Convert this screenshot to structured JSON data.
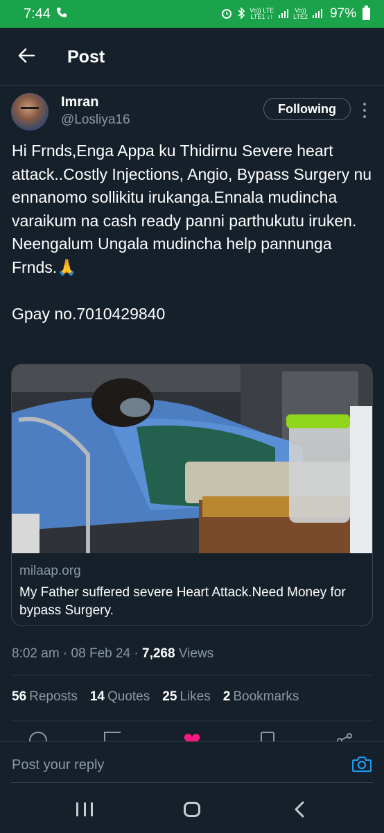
{
  "status_bar": {
    "time": "7:44",
    "network_left": "Vo)) LTE\nLTE1 ↓↑",
    "network_right": "Vo))\nLTE2",
    "battery": "97%",
    "bg_color": "#1aa34a"
  },
  "header": {
    "title": "Post",
    "back_icon": "arrow-left-icon"
  },
  "author": {
    "name": "Imran",
    "handle": "@Losliya16",
    "follow_label": "Following"
  },
  "post": {
    "text": "Hi Frnds,Enga Appa ku Thidirnu Severe heart attack..Costly Injections, Angio, Bypass Surgery nu ennanomo sollikitu irukanga.Ennala mudincha varaikum na cash ready panni parthukutu iruken. Neengalum Ungala mudincha help pannunga Frnds.🙏\n\nGpay no.7010429840"
  },
  "card": {
    "domain": "milaap.org",
    "description": "My Father suffered severe Heart Attack.Need Money for bypass Surgery."
  },
  "meta": {
    "time": "8:02 am",
    "separator": " · ",
    "date": "08 Feb 24",
    "views_count": "7,268",
    "views_label": " Views"
  },
  "stats": [
    {
      "count": "56",
      "label": "Reposts"
    },
    {
      "count": "14",
      "label": "Quotes"
    },
    {
      "count": "25",
      "label": "Likes"
    },
    {
      "count": "2",
      "label": "Bookmarks"
    }
  ],
  "reply": {
    "placeholder": "Post your reply"
  },
  "colors": {
    "background": "#15202b",
    "accent": "#1d9bf0",
    "like": "#f91880",
    "secondary_text": "#8b98a5"
  }
}
